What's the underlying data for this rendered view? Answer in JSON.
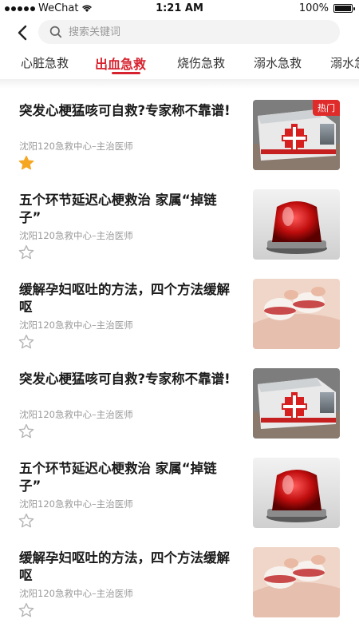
{
  "status_bar": {
    "carrier": "WeChat",
    "time": "1:21 AM",
    "battery": "100%",
    "battery_level": 1.0
  },
  "search": {
    "placeholder": "搜索关键词"
  },
  "tabs": [
    {
      "label": "心脏急救",
      "active": false
    },
    {
      "label": "出血急救",
      "active": true
    },
    {
      "label": "烧伤急救",
      "active": false
    },
    {
      "label": "溺水急救",
      "active": false
    },
    {
      "label": "溺水急",
      "active": false
    }
  ],
  "articles": [
    {
      "title": "突发心梗猛咳可自救?专家称不靠谱!",
      "source": "沈阳120急救中心–主治医师",
      "starred": true,
      "thumb": "ambulance",
      "badge": "热门"
    },
    {
      "title": "五个环节延迟心梗救治 家属“掉链子”",
      "source": "沈阳120急救中心–主治医师",
      "starred": false,
      "thumb": "siren",
      "badge": ""
    },
    {
      "title": "缓解孕妇呕吐的方法，四个方法缓解呕",
      "source": "沈阳120急救中心–主治医师",
      "starred": false,
      "thumb": "baby-shoes",
      "badge": ""
    },
    {
      "title": "突发心梗猛咳可自救?专家称不靠谱!",
      "source": "沈阳120急救中心–主治医师",
      "starred": false,
      "thumb": "ambulance",
      "badge": ""
    },
    {
      "title": "五个环节延迟心梗救治 家属“掉链子”",
      "source": "沈阳120急救中心–主治医师",
      "starred": false,
      "thumb": "siren",
      "badge": ""
    },
    {
      "title": "缓解孕妇呕吐的方法，四个方法缓解呕",
      "source": "沈阳120急救中心–主治医师",
      "starred": false,
      "thumb": "baby-shoes",
      "badge": ""
    }
  ],
  "colors": {
    "accent": "#d7232f",
    "star_filled": "#f5a623",
    "star_empty": "#b5b5b5"
  },
  "icons": {
    "back": "chevron-left-icon",
    "search": "search-icon",
    "star": "star-icon",
    "wifi": "wifi-icon",
    "battery": "battery-icon"
  }
}
